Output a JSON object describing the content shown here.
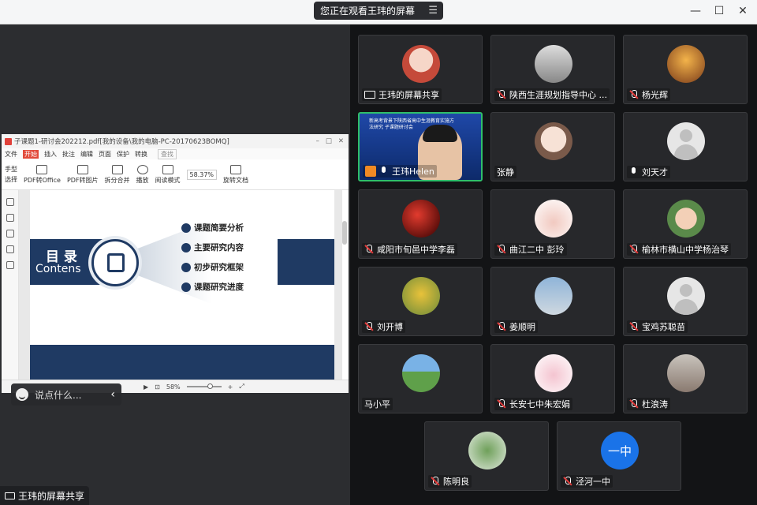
{
  "topbar": {
    "sharing_text": "您正在观看王玮的屏幕",
    "menu_icon": "list-icon"
  },
  "window_controls": [
    "minimize-icon",
    "maximize-icon",
    "close-icon"
  ],
  "left": {
    "bottom_label": "王玮的屏幕共享",
    "chat_placeholder": "说点什么...",
    "pdf": {
      "title": "子课题1-研讨会202212.pdf[我的设备\\我的电脑-PC-20170623BOMQ]",
      "menu": [
        "文件",
        "开始",
        "插入",
        "批注",
        "编辑",
        "页面",
        "保护",
        "转换"
      ],
      "menu_active": "开始",
      "search": "查找",
      "tools": [
        "手型",
        "选择",
        "PDF转Office",
        "PDF转图片",
        "拆分合并",
        "播放",
        "阅读模式",
        "旋转文档"
      ],
      "zoom": "58.37%",
      "status_zoom": "58%",
      "slide": {
        "title_cn": "目 录",
        "title_en": "Contens",
        "items": [
          "课题简要分析",
          "主要研究内容",
          "初步研究框架",
          "课题研究进度"
        ]
      }
    }
  },
  "participants": [
    {
      "name": "王玮的屏幕共享",
      "status": "screen",
      "avatar": "cartoon-girl"
    },
    {
      "name": "陕西生涯规划指导中心 ...",
      "status": "muted",
      "avatar": "hooded-figure"
    },
    {
      "name": "杨光辉",
      "status": "muted",
      "avatar": "autumn-tree"
    },
    {
      "name": "王玮Helen",
      "status": "speaking",
      "avatar": "video",
      "slide_text": "新高考背景下陕西省高中生涯教育实施方法研究 子课题研讨会"
    },
    {
      "name": "张静",
      "status": "none",
      "avatar": "anime-girl"
    },
    {
      "name": "刘天才",
      "status": "mic-on",
      "avatar": "default"
    },
    {
      "name": "咸阳市旬邑中学李磊",
      "status": "muted",
      "avatar": "red-flag"
    },
    {
      "name": "曲江二中  彭玲",
      "status": "muted",
      "avatar": "food"
    },
    {
      "name": "榆林市横山中学杨治琴",
      "status": "muted",
      "avatar": "baby"
    },
    {
      "name": "刘开博",
      "status": "muted",
      "avatar": "yellow-tree"
    },
    {
      "name": "姜顺明",
      "status": "muted",
      "avatar": "tower"
    },
    {
      "name": "宝鸡苏聪苗",
      "status": "muted",
      "avatar": "default"
    },
    {
      "name": "马小平",
      "status": "none",
      "avatar": "landscape"
    },
    {
      "name": "长安七中朱宏娟",
      "status": "muted",
      "avatar": "pink-food"
    },
    {
      "name": "杜浪涛",
      "status": "muted",
      "avatar": "child"
    },
    {
      "name": "陈明良",
      "status": "muted",
      "avatar": "plant"
    },
    {
      "name": "泾河一中",
      "status": "muted",
      "avatar": "text",
      "avatar_text": "一中"
    }
  ],
  "colors": {
    "accent_green": "#2fbf6a",
    "mute_red": "#e23b3b",
    "slide_navy": "#1f3a63"
  }
}
